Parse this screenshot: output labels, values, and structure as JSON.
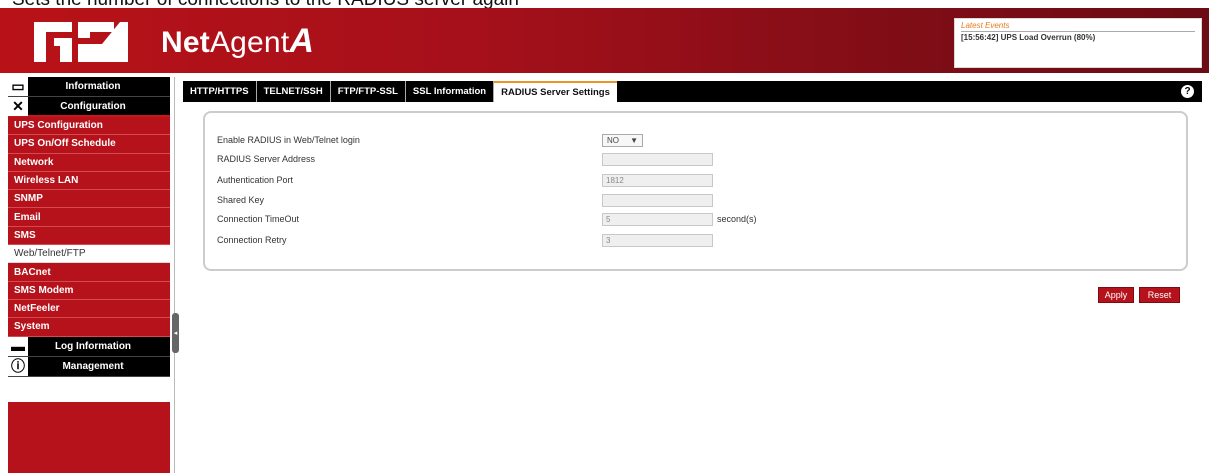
{
  "caption": "Sets the number of connections to the RADIUS server again",
  "header": {
    "brand_prefix": "Net",
    "brand_middle": "Agent",
    "brand_suffix": "A",
    "events_title": "Latest Events",
    "events_line": "[15:56:42] UPS Load Overrun (80%)"
  },
  "sidebar": {
    "information": "Information",
    "configuration": "Configuration",
    "items": [
      "UPS Configuration",
      "UPS On/Off Schedule",
      "Network",
      "Wireless LAN",
      "SNMP",
      "Email",
      "SMS",
      "Web/Telnet/FTP",
      "BACnet",
      "SMS Modem",
      "NetFeeler",
      "System"
    ],
    "active_item": "Web/Telnet/FTP",
    "log_information": "Log Information",
    "management": "Management"
  },
  "tabs": [
    "HTTP/HTTPS",
    "TELNET/SSH",
    "FTP/FTP-SSL",
    "SSL Information",
    "RADIUS Server Settings"
  ],
  "active_tab": "RADIUS Server Settings",
  "form": {
    "enable_label": "Enable RADIUS in Web/Telnet login",
    "enable_value": "NO",
    "address_label": "RADIUS Server Address",
    "address_value": "",
    "auth_port_label": "Authentication Port",
    "auth_port_value": "1812",
    "shared_key_label": "Shared Key",
    "shared_key_value": "",
    "timeout_label": "Connection TimeOut",
    "timeout_value": "5",
    "timeout_unit": "second(s)",
    "retry_label": "Connection Retry",
    "retry_value": "3"
  },
  "buttons": {
    "apply": "Apply",
    "reset": "Reset"
  },
  "colors": {
    "brand_red": "#b5121b",
    "accent_orange": "#e89428"
  }
}
